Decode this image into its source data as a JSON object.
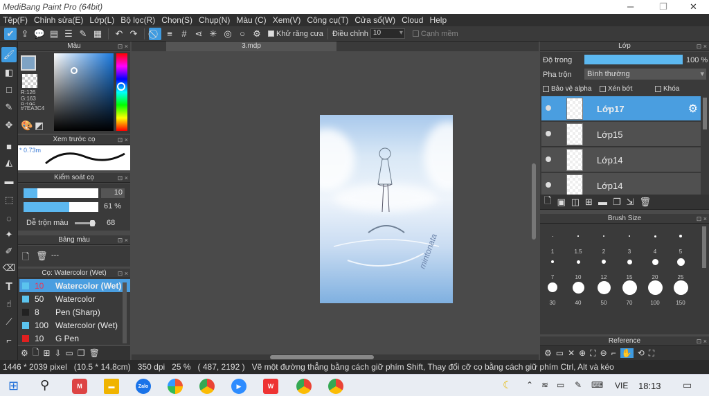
{
  "window": {
    "title": "MediBang Paint Pro (64bit)"
  },
  "menu": [
    "Tệp(F)",
    "Chỉnh sửa(E)",
    "Lớp(L)",
    "Bộ lọc(R)",
    "Chọn(S)",
    "Chụp(N)",
    "Màu (C)",
    "Xem(V)",
    "Công cụ(T)",
    "Cửa sổ(W)",
    "Cloud",
    "Help"
  ],
  "toolbar": {
    "antialias": "Khử răng cưa",
    "adjust": "Điều chỉnh",
    "adjust_value": "10",
    "edge": "Cạnh mềm"
  },
  "color_panel": {
    "title": "Màu",
    "r": "R:126",
    "g": "G:163",
    "b": "B:196",
    "hex": "#7EA3C4",
    "main_color": "#7EA3C4"
  },
  "brush_preview": {
    "title": "Xem trước cọ",
    "size": "* 0.73m"
  },
  "brush_control": {
    "title": "Kiểm soát cọ",
    "size": "10",
    "opacity": "61 %",
    "opacity_fraction": 0.61,
    "blend_label": "Dễ trộn màu",
    "blend_value": "68"
  },
  "palette": {
    "title": "Bảng màu",
    "value": "---"
  },
  "brush_list": {
    "title": "Cọ: Watercolor (Wet)",
    "items": [
      {
        "size": "10",
        "name": "Watercolor (Wet)",
        "color": "#5bc3ee",
        "selected": true
      },
      {
        "size": "50",
        "name": "Watercolor",
        "color": "#5bc3ee",
        "selected": false
      },
      {
        "size": "8",
        "name": "Pen (Sharp)",
        "color": "#222222",
        "selected": false
      },
      {
        "size": "100",
        "name": "Watercolor (Wet)",
        "color": "#5bc3ee",
        "selected": false
      },
      {
        "size": "10",
        "name": "G Pen",
        "color": "#e02020",
        "selected": false
      }
    ]
  },
  "canvas": {
    "tab": "3.mdp",
    "signature": "mintonata"
  },
  "layer_panel": {
    "title": "Lớp",
    "opacity_label": "Độ trong",
    "opacity_value": "100 %",
    "blend_label": "Pha trộn",
    "blend_value": "Bình thường",
    "protect_alpha": "Bảo vệ alpha",
    "clipping": "Xén bớt",
    "lock": "Khóa",
    "layers": [
      {
        "name": "Lớp17",
        "selected": true
      },
      {
        "name": "Lớp15",
        "selected": false
      },
      {
        "name": "Lớp14",
        "selected": false
      },
      {
        "name": "Lớp14",
        "selected": false
      }
    ]
  },
  "brush_size_panel": {
    "title": "Brush Size",
    "sizes": [
      "1",
      "1.5",
      "2",
      "3",
      "4",
      "5",
      "7",
      "10",
      "12",
      "15",
      "20",
      "25",
      "30",
      "40",
      "50",
      "70",
      "100",
      "150"
    ]
  },
  "reference_panel": {
    "title": "Reference"
  },
  "status": {
    "dims": "1446 * 2039 pixel",
    "cm": "(10.5 * 14.8cm)",
    "dpi": "350 dpi",
    "zoom": "25 %",
    "coords": "( 487, 2192 )",
    "hint": "Vẽ một đường thẳng bằng cách giữ phím Shift, Thay đổi cỡ cọ bằng cách giữ phím Ctrl, Alt và kéo"
  },
  "taskbar": {
    "lang": "VIE",
    "time": "18:13",
    "zalo": "Zalo"
  }
}
